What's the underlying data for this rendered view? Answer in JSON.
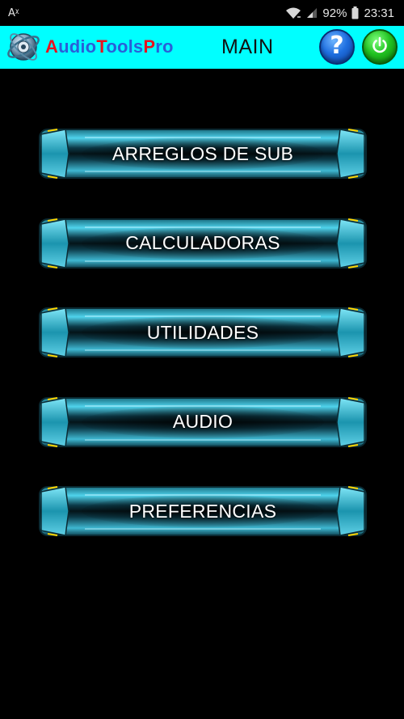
{
  "status_bar": {
    "left_indicator": "Aᵡ",
    "battery_percent": "92%",
    "time": "23:31"
  },
  "app_bar": {
    "title_parts": [
      {
        "text": "A",
        "color": "#e8121e"
      },
      {
        "text": "udio",
        "color": "#2a5fd8"
      },
      {
        "text": "T",
        "color": "#e8121e"
      },
      {
        "text": "ools",
        "color": "#2a5fd8"
      },
      {
        "text": "P",
        "color": "#e8121e"
      },
      {
        "text": "ro",
        "color": "#2a5fd8"
      }
    ],
    "page_title": "MAIN",
    "help_label": "?",
    "background": "#00ffff"
  },
  "menu": {
    "items": [
      {
        "label": "ARREGLOS DE SUB"
      },
      {
        "label": "CALCULADORAS"
      },
      {
        "label": "UTILIDADES"
      },
      {
        "label": "AUDIO"
      },
      {
        "label": "PREFERENCIAS"
      }
    ]
  },
  "icons": {
    "logo": "audio-tools-logo-icon",
    "help": "help-icon",
    "power": "power-icon",
    "wifi": "wifi-icon",
    "signal": "signal-icon",
    "battery": "battery-icon"
  }
}
